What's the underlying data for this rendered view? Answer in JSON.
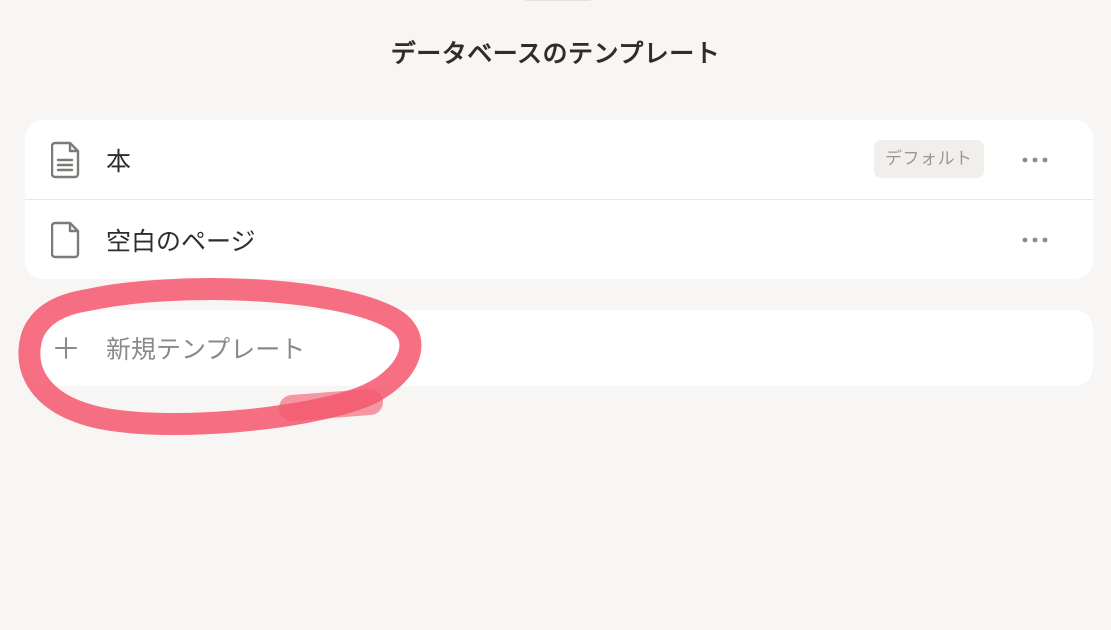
{
  "sheet": {
    "title": "データベースのテンプレート"
  },
  "templates": [
    {
      "label": "本",
      "icon": "document-lines-icon",
      "badge": "デフォルト",
      "more": "more-icon"
    },
    {
      "label": "空白のページ",
      "icon": "document-blank-icon",
      "more": "more-icon"
    }
  ],
  "new_template": {
    "label": "新規テンプレート",
    "icon": "plus-icon"
  },
  "colors": {
    "background": "#f8f6f4",
    "card": "#ffffff",
    "text": "#2f2d2a",
    "muted": "#8c8a86",
    "badge_bg": "#f1efec",
    "annotation": "#f4566c"
  }
}
